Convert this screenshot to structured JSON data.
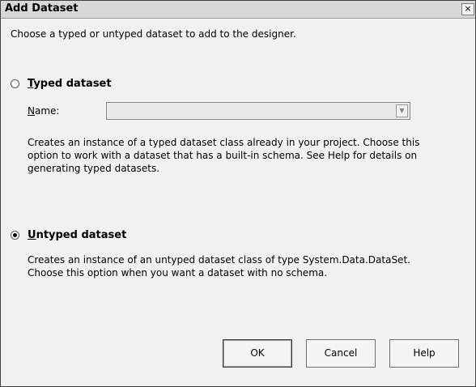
{
  "window": {
    "title": "Add Dataset",
    "close_glyph": "×"
  },
  "intro": "Choose a typed or untyped dataset to add to the designer.",
  "typed": {
    "label_first": "T",
    "label_rest": "yped dataset",
    "selected": false,
    "name_label_first": "N",
    "name_label_rest": "ame:",
    "name_value": "",
    "description": "Creates an instance of a typed dataset class already in your project. Choose this option to work with a dataset that has a built-in schema. See Help for details on generating typed datasets."
  },
  "untyped": {
    "label_first": "U",
    "label_rest": "ntyped dataset",
    "selected": true,
    "description": "Creates an instance of an untyped dataset class of type System.Data.DataSet. Choose this option when you want a dataset with no schema."
  },
  "buttons": {
    "ok": "OK",
    "cancel": "Cancel",
    "help": "Help"
  },
  "icons": {
    "combo_arrow": "chevron-down-icon"
  }
}
